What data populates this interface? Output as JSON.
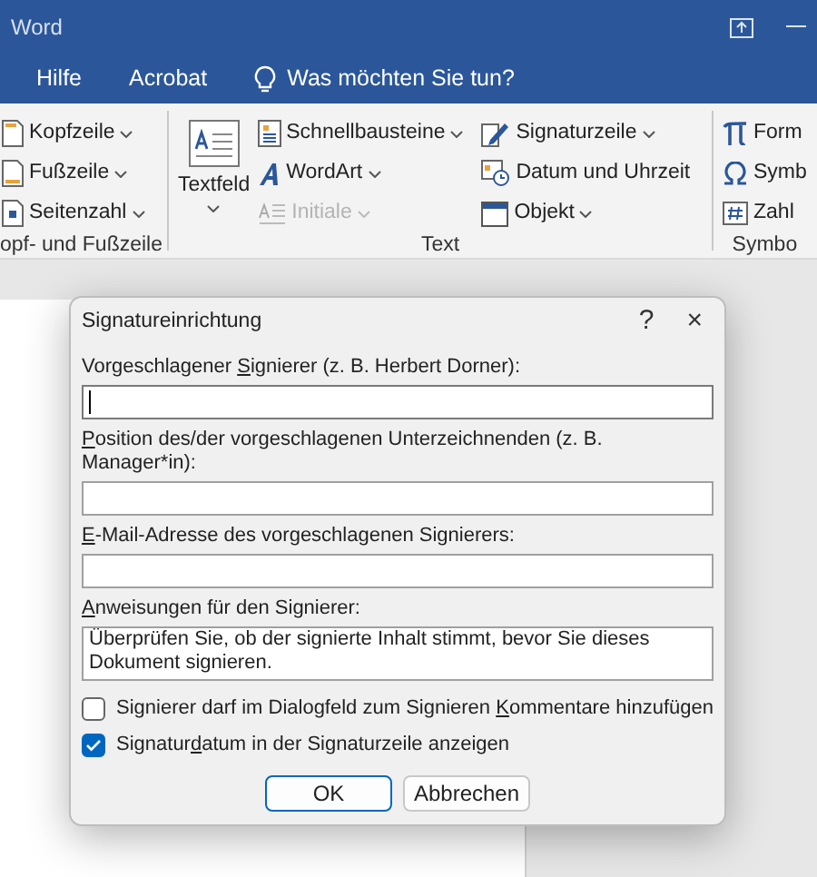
{
  "window": {
    "title": "Word"
  },
  "tabs": [
    {
      "label": "Hilfe",
      "selected": false
    },
    {
      "label": "Acrobat",
      "selected": false
    }
  ],
  "tell_me": {
    "label": "Was möchten Sie tun?"
  },
  "ribbon": {
    "groups": [
      {
        "label": "opf- und Fußzeile",
        "columns": [
          [
            {
              "kind": "small",
              "label": "Kopfzeile",
              "dropdown": true,
              "disabled": false
            },
            {
              "kind": "small",
              "label": "Fußzeile",
              "dropdown": true,
              "disabled": false
            },
            {
              "kind": "small",
              "label": "Seitenzahl",
              "dropdown": true,
              "disabled": false
            }
          ]
        ]
      },
      {
        "label": "Text",
        "columns": [
          [
            {
              "kind": "large",
              "label": "Textfeld",
              "dropdown": true,
              "disabled": false
            }
          ],
          [
            {
              "kind": "small",
              "label": "Schnellbausteine",
              "dropdown": true,
              "disabled": false
            },
            {
              "kind": "small",
              "label": "WordArt",
              "dropdown": true,
              "disabled": false
            },
            {
              "kind": "small",
              "label": "Initiale",
              "dropdown": true,
              "disabled": true
            }
          ],
          [
            {
              "kind": "small",
              "label": "Signaturzeile",
              "dropdown": true,
              "disabled": false
            },
            {
              "kind": "small",
              "label": "Datum und Uhrzeit",
              "dropdown": false,
              "disabled": false
            },
            {
              "kind": "small",
              "label": "Objekt",
              "dropdown": true,
              "disabled": false
            }
          ]
        ]
      },
      {
        "label": "Symbo",
        "columns": [
          [
            {
              "kind": "small",
              "label": "Form",
              "dropdown": false,
              "disabled": false
            },
            {
              "kind": "small",
              "label": "Symb",
              "dropdown": false,
              "disabled": false
            },
            {
              "kind": "small",
              "label": "Zahl",
              "dropdown": false,
              "disabled": false
            }
          ]
        ]
      }
    ]
  },
  "dialog": {
    "title": "Signatureinrichtung",
    "help": "?",
    "close": "×",
    "fields": [
      {
        "kind": "input",
        "label": {
          "before": "Vorgeschlagener ",
          "key": "S",
          "after": "ignierer (z. B. Herbert Dorner):"
        },
        "focused": true
      },
      {
        "kind": "input",
        "label": {
          "key": "P",
          "after": "osition des/der vorgeschlagenen Unterzeichnenden (z. B. Manager*in):"
        },
        "focused": false
      },
      {
        "kind": "input",
        "label": {
          "key": "E",
          "after": "-Mail-Adresse des vorgeschlagenen Signierers:"
        },
        "focused": false
      },
      {
        "kind": "textarea",
        "label": {
          "key": "A",
          "after": "nweisungen für den Signierer:"
        },
        "value": "Überprüfen Sie, ob der signierte Inhalt stimmt, bevor Sie dieses Dokument signieren.",
        "focused": false
      }
    ],
    "checkboxes": [
      {
        "label": {
          "before": "Signierer darf im Dialogfeld zum Signieren ",
          "key": "K",
          "after": "ommentare hinzufügen"
        },
        "checked": false
      },
      {
        "label": {
          "before": "Signatur",
          "key": "d",
          "after": "atum in der Signaturzeile anzeigen"
        },
        "checked": true
      }
    ],
    "buttons": [
      {
        "label": "OK",
        "default": true
      },
      {
        "label": "Abbrechen",
        "default": false
      }
    ]
  }
}
